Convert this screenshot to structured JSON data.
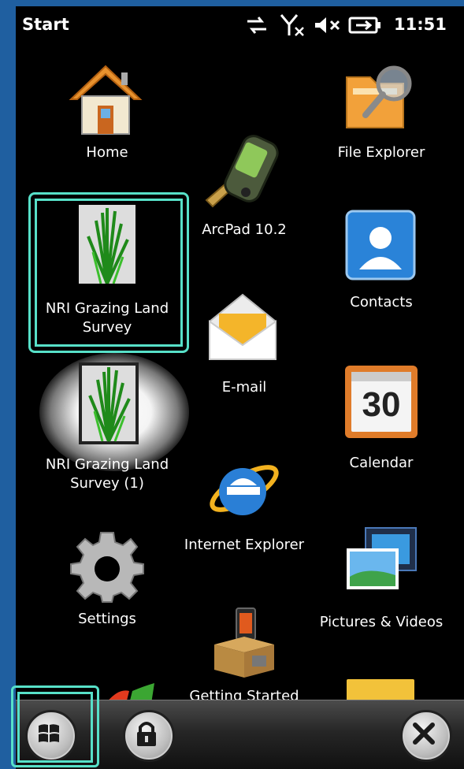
{
  "status_bar": {
    "title": "Start",
    "time": "11:51",
    "icons": [
      "sync-arrows-icon",
      "no-signal-icon",
      "speaker-muted-icon",
      "battery-charging-icon"
    ]
  },
  "apps": {
    "home": "Home",
    "file_explorer": "File Explorer",
    "arcpad": "ArcPad 10.2",
    "nri_grazing_1": "NRI Grazing Land\nSurvey",
    "contacts": "Contacts",
    "email": "E-mail",
    "nri_grazing_2": "NRI Grazing Land\nSurvey (1)",
    "calendar": "Calendar",
    "calendar_day": "30",
    "internet_explorer": "Internet Explorer",
    "settings": "Settings",
    "pictures_videos": "Pictures & Videos",
    "getting_started": "Getting Started"
  },
  "taskbar": {
    "buttons": [
      "windows-start-icon",
      "lock-icon",
      "close-icon"
    ]
  },
  "colors": {
    "background_frame": "#1f5fa0",
    "highlight": "#57e0c8"
  }
}
